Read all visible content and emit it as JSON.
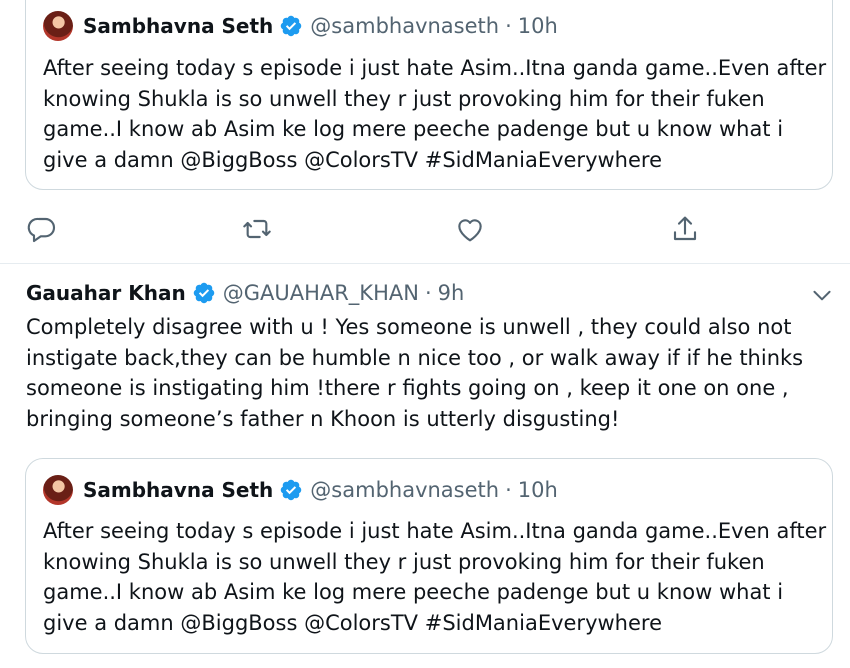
{
  "quoted_tweet": {
    "name": "Sambhavna Seth",
    "handle": "@sambhavnaseth",
    "time": "10h",
    "lines": [
      "After seeing today s episode i just hate Asim..Itna ganda game..Even after",
      "knowing Shukla is so unwell they r just provoking him for their fuken",
      "game..I know ab Asim ke log mere peeche padenge but u know what i",
      "give a damn @BiggBoss @ColorsTV #SidManiaEverywhere"
    ]
  },
  "actions": {
    "icons": [
      "reply-icon",
      "retweet-icon",
      "like-icon",
      "share-icon"
    ]
  },
  "reply_tweet": {
    "name": "Gauahar Khan",
    "handle": "@GAUAHAR_KHAN",
    "time": "9h",
    "lines": [
      "Completely disagree with u ! Yes someone is unwell , they could also not",
      "instigate back,they can be humble n nice too , or walk away if if he thinks",
      "someone is instigating him !there r fights going on , keep it one on one ,",
      "bringing someone’s father n Khoon is utterly disgusting!"
    ],
    "quoted": {
      "name": "Sambhavna Seth",
      "handle": "@sambhavnaseth",
      "time": "10h",
      "lines": [
        "After seeing today s episode i just hate Asim..Itna ganda game..Even after",
        "knowing Shukla is so unwell they r just provoking him for their fuken",
        "game..I know ab Asim ke log mere peeche padenge but u know what i",
        "give a damn @BiggBoss @ColorsTV #SidManiaEverywhere"
      ]
    }
  },
  "separator": "·",
  "colors": {
    "text": "#0f1419",
    "muted": "#536471",
    "verified": "#1d9bf0",
    "border": "#cfd9de"
  }
}
